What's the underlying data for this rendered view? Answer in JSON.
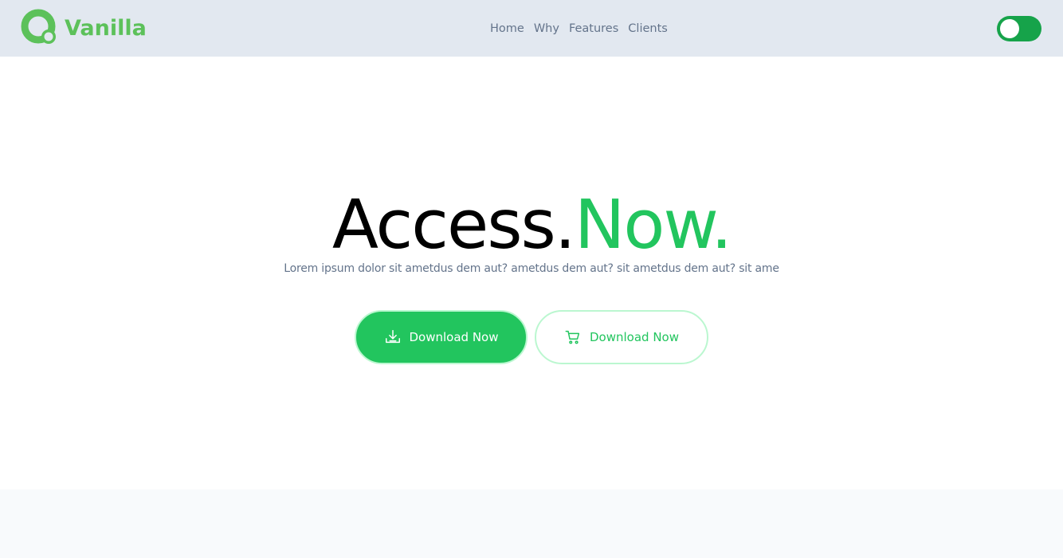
{
  "brand": {
    "name": "Vanilla",
    "logo_icon": "vanilla-logo-icon",
    "color": "#5cc15a"
  },
  "nav": {
    "links": [
      "Home",
      "Why",
      "Features",
      "Clients"
    ]
  },
  "theme_toggle": {
    "icon": "toggle-switch",
    "state": "on",
    "color": "#16a34a"
  },
  "hero": {
    "headline_main": "Access.",
    "headline_accent": "Now.",
    "accent_color": "#22c55e",
    "subtitle": "Lorem ipsum dolor sit ametdus dem aut? ametdus dem aut? sit ametdus dem aut? sit ame",
    "primary_button": {
      "label": "Download Now",
      "icon": "download-icon"
    },
    "secondary_button": {
      "label": "Download Now",
      "icon": "cart-icon"
    }
  }
}
